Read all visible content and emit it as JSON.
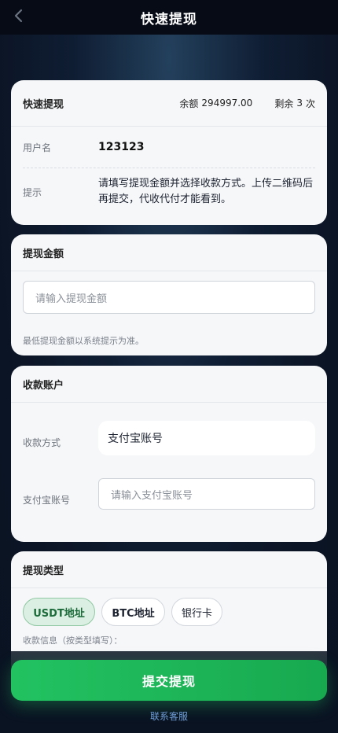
{
  "header": {
    "title": "快速提现",
    "back_icon": "chevron-left-icon"
  },
  "summary": {
    "title": "快速提现",
    "balance_label": "余额",
    "balance_value": "294997.00",
    "remaining_label": "剩余",
    "remaining_value": "3",
    "remaining_unit": "次",
    "username_label": "用户名",
    "username_value": "123123",
    "tip_label": "提示",
    "tip_text": "请填写提现金额并选择收款方式。上传二维码后再提交，代收代付才能看到。"
  },
  "amount": {
    "title": "提现金额",
    "placeholder": "请输入提现金额",
    "note": "最低提现金额以系统提示为准。"
  },
  "account": {
    "title": "收款账户",
    "method_label": "收款方式",
    "method_value": "支付宝账号",
    "account_label": "支付宝账号",
    "account_placeholder": "请输入支付宝账号"
  },
  "withdraw_type": {
    "title": "提现类型",
    "options": [
      "USDT地址",
      "BTC地址",
      "银行卡"
    ],
    "selected": "USDT地址",
    "fill_hint": "收款信息（按类型填写）："
  },
  "footer": {
    "submit_label": "提交提现",
    "service_label": "联系客服"
  },
  "colors": {
    "accent_green": "#22c261",
    "link_blue": "#6f9cd6",
    "selected_pill_bg": "#dcefe3"
  }
}
